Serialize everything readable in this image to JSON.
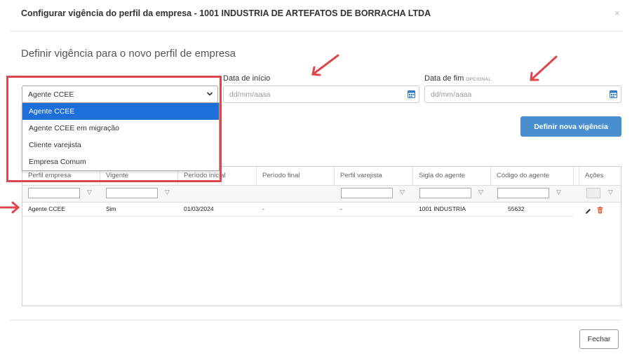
{
  "modal": {
    "title": "Configurar vigência do perfil da empresa - 1001 INDUSTRIA DE ARTEFATOS DE BORRACHA LTDA",
    "close_glyph": "×"
  },
  "form": {
    "subtitle": "Definir vigência para o novo perfil de empresa",
    "profile_select": {
      "value": "Agente CCEE",
      "options": [
        "Agente CCEE",
        "Agente CCEE em migração",
        "Cliente varejista",
        "Empresa Comum"
      ]
    },
    "start_date": {
      "label": "Data de início",
      "placeholder": "dd/mm/aaaa"
    },
    "end_date": {
      "label": "Data de fim",
      "optional": "OPCIONAL",
      "placeholder": "dd/mm/aaaa"
    },
    "submit_label": "Definir nova vigência"
  },
  "table": {
    "columns": [
      "Perfil empresa",
      "Vigente",
      "Período inicial",
      "Período final",
      "Perfil varejista",
      "Sigla do agente",
      "Código do agente",
      "Ações"
    ],
    "rows": [
      [
        "Agente CCEE",
        "Sim",
        "01/03/2024",
        "-",
        "-",
        "1001 INDUSTRIA",
        "55632"
      ]
    ]
  },
  "footer": {
    "close_label": "Fechar"
  },
  "colors": {
    "accent": "#4a90d0",
    "selected": "#1e6fd9",
    "annotation": "#e0474c",
    "delete": "#e05a2b"
  },
  "icons": [
    "calendar-icon",
    "chevron-down-icon",
    "filter-icon",
    "edit-icon",
    "trash-icon",
    "annotation-arrow"
  ]
}
